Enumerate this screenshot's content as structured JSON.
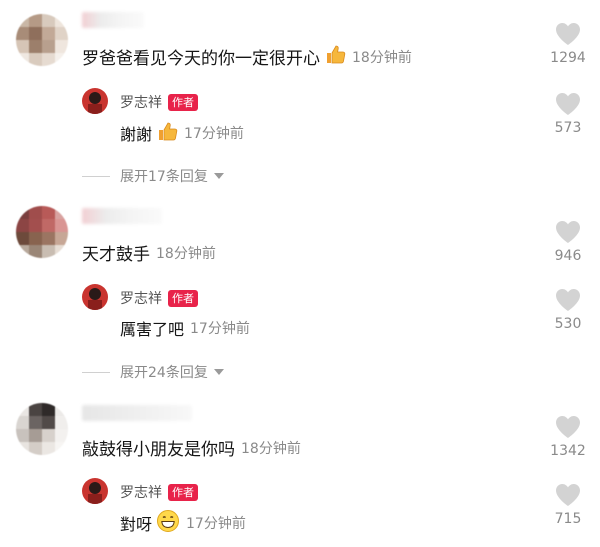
{
  "threads": [
    {
      "comment": {
        "text": "罗爸爸看见今天的你一定很开心",
        "emoji": "thumbs-up-icon",
        "time": "18分钟前",
        "likes": "1294"
      },
      "reply": {
        "name": "罗志祥",
        "tag": "作者",
        "text": "謝謝",
        "emoji": "thumbs-up-icon",
        "time": "17分钟前",
        "likes": "573"
      },
      "expand": "展开17条回复"
    },
    {
      "comment": {
        "text": "天才鼓手",
        "time": "18分钟前",
        "likes": "946"
      },
      "reply": {
        "name": "罗志祥",
        "tag": "作者",
        "text": "厲害了吧",
        "time": "17分钟前",
        "likes": "530"
      },
      "expand": "展开24条回复"
    },
    {
      "comment": {
        "text": "敲鼓得小朋友是你吗",
        "time": "18分钟前",
        "likes": "1342"
      },
      "reply": {
        "name": "罗志祥",
        "tag": "作者",
        "text": "對呀",
        "emoji": "grinning-face-icon",
        "time": "17分钟前",
        "likes": "715"
      }
    }
  ],
  "colors": {
    "author_tag": "#e8234a",
    "meta_text": "#8a8a8a",
    "heart": "#d3d3d3"
  }
}
